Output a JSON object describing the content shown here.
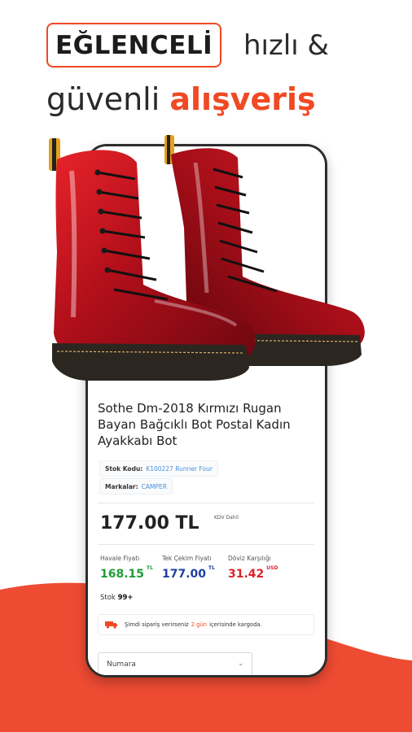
{
  "headline": {
    "box_word": "EĞLENCELİ",
    "word_fast": "hızlı &",
    "word_safe": "güvenli",
    "word_shopping": "alışveriş"
  },
  "colors": {
    "accent": "#f04923",
    "wave": "#ee4b33",
    "phone_frame": "#2d2d2d",
    "price_transfer": "#1f9d3a",
    "price_single": "#1f3fa6",
    "price_fx": "#d9242b"
  },
  "product": {
    "image_icon": "red-patent-boots-image",
    "title": "Sothe Dm-2018 Kırmızı Rugan Bayan Bağcıklı Bot Postal Kadın Ayakkabı Bot",
    "stock_code_label": "Stok Kodu:",
    "stock_code_value": "K100227 Runner Four",
    "brand_label": "Markalar:",
    "brand_value": "CAMPER",
    "price": "177.00 TL",
    "vat_note": "KDV Dahil",
    "prices": [
      {
        "label": "Havale Fiyatı",
        "amount": "168.15",
        "currency": "TL"
      },
      {
        "label": "Tek Çekim Fiyatı",
        "amount": "177.00",
        "currency": "TL"
      },
      {
        "label": "Döviz Karşılığı",
        "amount": "31.42",
        "currency": "USD"
      }
    ],
    "stock_label": "Stok",
    "stock_value": "99+",
    "shipping_icon": "truck-icon",
    "shipping_pre": "Şimdi sipariş verirseniz",
    "shipping_days": "2 gün",
    "shipping_post": "içerisinde kargoda.",
    "size_select_value": "Numara"
  }
}
